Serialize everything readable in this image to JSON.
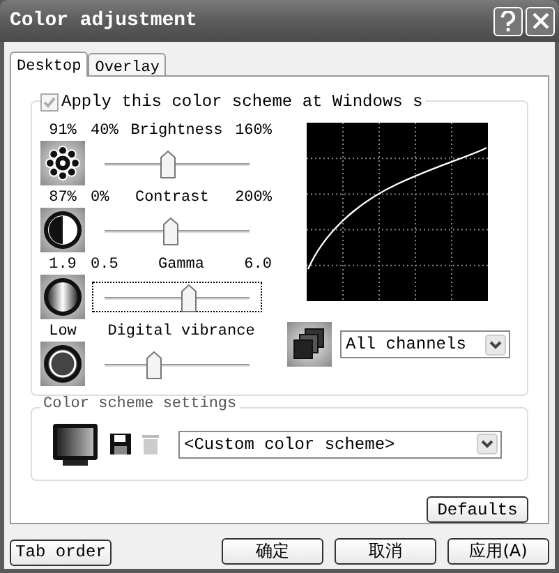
{
  "window": {
    "title": "Color adjustment"
  },
  "tabs": [
    {
      "label": "Desktop",
      "selected": true
    },
    {
      "label": "Overlay",
      "selected": false
    }
  ],
  "apply_checkbox": {
    "label": "Apply this color scheme at Windows s",
    "checked": true,
    "disabled": true
  },
  "sliders": [
    {
      "kind": "brightness",
      "reading": "91%",
      "min": "40%",
      "name": "Brightness",
      "max": "160%",
      "level": 0.43,
      "focused": false
    },
    {
      "kind": "contrast",
      "reading": "87%",
      "min": "0%",
      "name": "Contrast",
      "max": "200%",
      "level": 0.45,
      "focused": false
    },
    {
      "kind": "gamma",
      "reading": "1.9",
      "min": "0.5",
      "name": "Gamma",
      "max": "6.0",
      "level": 0.58,
      "focused": true
    },
    {
      "kind": "vibrance",
      "reading": "Low",
      "name": "Digital vibrance",
      "level": 0.34,
      "focused": false
    }
  ],
  "channel_dropdown": {
    "value": "All channels"
  },
  "color_scheme_group": {
    "title": "Color scheme settings",
    "scheme_dropdown": {
      "value": "<Custom color scheme>"
    },
    "delete_disabled": true
  },
  "defaults_button": "Defaults",
  "footer_buttons": [
    {
      "label": "Tab order",
      "kind": "left"
    },
    {
      "label": "确定",
      "kind": "right"
    },
    {
      "label": "取消",
      "kind": "right"
    },
    {
      "label": "应用(A)",
      "kind": "right"
    }
  ]
}
